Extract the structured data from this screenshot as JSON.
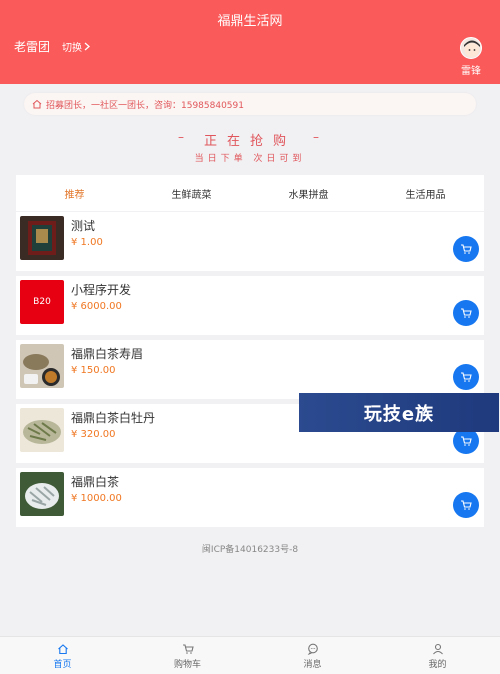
{
  "header": {
    "title": "福鼎生活网",
    "community": "老雷团",
    "switch_label": "切换",
    "user_name": "雷锋"
  },
  "notice": {
    "text": "招募团长，一社区一团长，咨询：15985840591"
  },
  "sale": {
    "title": "正在抢购",
    "subtitle": "当日下单 次日可到"
  },
  "tabs": [
    {
      "label": "推荐",
      "active": true
    },
    {
      "label": "生鲜蔬菜"
    },
    {
      "label": "水果拼盘"
    },
    {
      "label": "生活用品"
    }
  ],
  "products": [
    {
      "name": "测试",
      "price": "¥ 1.00",
      "thumb_icon": "tea-box-image"
    },
    {
      "name": "小程序开发",
      "price": "¥ 6000.00",
      "thumb_icon": "b20-image",
      "thumb_text": "B20"
    },
    {
      "name": "福鼎白茶寿眉",
      "price": "¥ 150.00",
      "thumb_icon": "tea-cup-image"
    },
    {
      "name": "福鼎白茶白牡丹",
      "price": "¥ 320.00",
      "thumb_icon": "tea-leaves-image"
    },
    {
      "name": "福鼎白茶",
      "price": "¥ 1000.00",
      "thumb_icon": "tea-leaves-image"
    }
  ],
  "icp": "闽ICP备14016233号-8",
  "watermark": "玩技e族",
  "bottom_nav": [
    {
      "label": "首页",
      "icon": "home-icon",
      "active": true
    },
    {
      "label": "购物车",
      "icon": "cart-icon"
    },
    {
      "label": "消息",
      "icon": "message-icon"
    },
    {
      "label": "我的",
      "icon": "user-icon"
    }
  ],
  "colors": {
    "header": "#fa5a59",
    "accent_blue": "#1677f0",
    "price": "#f07722",
    "active_tab": "#e2772b"
  }
}
